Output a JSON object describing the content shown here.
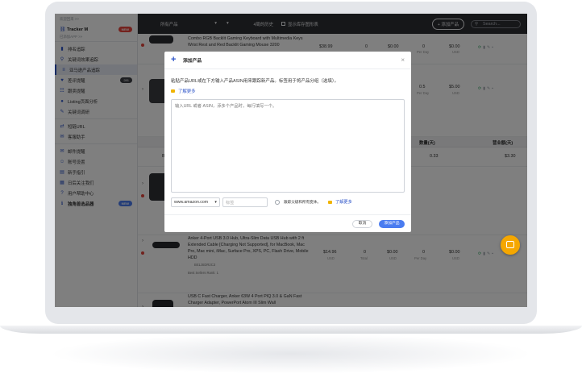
{
  "sidebar": {
    "top_small_1": "欢迎回来 >>",
    "account_name": "Tracker M",
    "new_badge": "NEW",
    "top_small_2": "已添加APP >>",
    "items": [
      {
        "label": "排名追踪",
        "icon": "chart-icon"
      },
      {
        "label": "关键词效果追踪",
        "icon": "search-icon"
      },
      {
        "label": "亚马逊产品追踪",
        "icon": "list-icon",
        "active": true
      },
      {
        "label": "差评提醒",
        "icon": "heart-icon",
        "badge": "281"
      },
      {
        "label": "跟卖提醒",
        "icon": "grid-icon"
      },
      {
        "label": "Listing页面分析",
        "icon": "bulb-icon"
      },
      {
        "label": "关键词调研",
        "icon": "wrench-icon"
      },
      {
        "label": "短链URL",
        "icon": "shuffle-icon"
      },
      {
        "label": "客服助手",
        "icon": "chat-icon"
      },
      {
        "label": "邮件提醒",
        "icon": "mail-icon"
      },
      {
        "label": "账号设置",
        "icon": "user-icon"
      },
      {
        "label": "新手指引",
        "icon": "doc-icon"
      },
      {
        "label": "日后关注我们",
        "icon": "calendar-icon"
      },
      {
        "label": "用户帮助中心",
        "icon": "help-icon"
      },
      {
        "label": "独角兽选品器",
        "icon": "info-icon",
        "badge_blue": "NEW"
      }
    ]
  },
  "topbar": {
    "product_filter": "所有产品",
    "history_filter": "4周的历史",
    "show_chart": "显示库存图形表",
    "add_button": "+ 添加产品",
    "search_placeholder": "Search..."
  },
  "table": {
    "row1_title": "Combo RGB Backlit Gaming Keyboard with Multimedia Keys Wrist Rest and Red Backlit Gaming Mouse 3200",
    "row1_price": "$38.99",
    "row1_qty": "0",
    "row1_rev": "$0.00",
    "row1_sales": "0",
    "row1_sales_sub": "Per Day",
    "row1_val": "$0.00",
    "row1_val_sub": "USD",
    "row2_sales": "0.5",
    "row2_sales_sub": "Per Day",
    "row2_val": "$5.00",
    "row2_val_sub": "USD",
    "header_qty": "数量(天)",
    "header_rev": "营业额(天)",
    "summary_left": "B",
    "summary_qty": "0.33",
    "summary_rev": "$3.30",
    "row4_title": "Anker 4-Port USB 3.0 Hub, Ultra-Slim Data USB Hub with 2 ft Extended Cable [Charging Not Supported], for MacBook, Mac Pro, Mac mini, iMac, Surface Pro, XPS, PC, Flash Drive, Mobile HDD",
    "row4_asin": "B01JSDR2C3",
    "row4_rank": "Best Sellers Rank: 1",
    "row4_price": "$14.96",
    "row4_price_sub": "USD",
    "row4_qty": "0",
    "row4_qty_sub": "Total",
    "row4_rev": "$0.00",
    "row4_rev_sub": "USD",
    "row4_sales": "0",
    "row4_sales_sub": "Per Day",
    "row4_val": "$0.00",
    "row4_val_sub": "USD",
    "row5_title": "USB C Fast Charger, Anker 63W 4 Port PIQ 3.0 & GaN Fast Charger Adapter, PowerPort Atom III Slim Wall"
  },
  "modal": {
    "title": "添加产品",
    "description": "粘贴产品URL或在下方输入产品ASIN用来跟踪新产品。标签用于将产品分组（选填）。",
    "learn_more": "了解更多",
    "textarea_placeholder": "输入URL 或者 ASIN，添多个产品时，每行填写一个。",
    "marketplace": "www.amazon.com",
    "label_placeholder": "标签",
    "track_variants": "跟踪父级和所有变体。",
    "learn_more_2": "了解更多",
    "cancel": "取消",
    "add": "添加产品"
  }
}
